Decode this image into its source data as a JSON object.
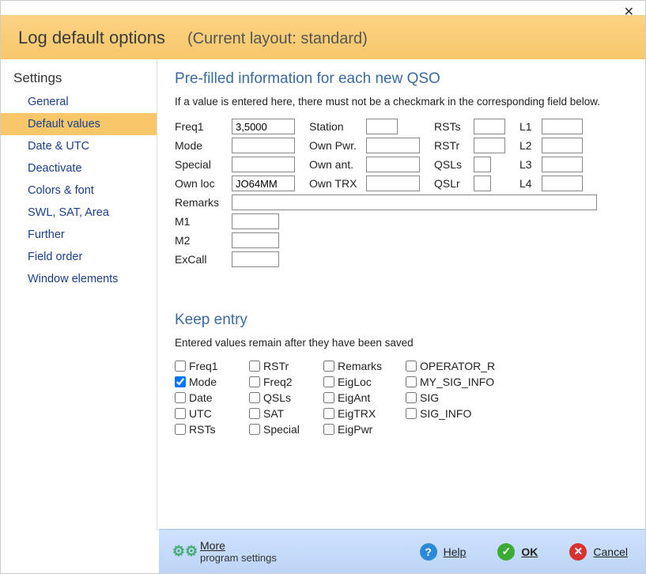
{
  "window": {
    "close": "✕"
  },
  "header": {
    "title": "Log default options",
    "layout": "(Current layout: standard)"
  },
  "sidebar": {
    "title": "Settings",
    "items": [
      {
        "label": "General"
      },
      {
        "label": "Default values"
      },
      {
        "label": "Date & UTC"
      },
      {
        "label": "Deactivate"
      },
      {
        "label": "Colors & font"
      },
      {
        "label": "SWL, SAT, Area"
      },
      {
        "label": "Further"
      },
      {
        "label": "Field order"
      },
      {
        "label": "Window elements"
      }
    ],
    "active_index": 1
  },
  "prefilled": {
    "title": "Pre-filled information for each new QSO",
    "note": "If a value is entered here, there must not be a checkmark in the corresponding field below.",
    "labels": {
      "freq1": "Freq1",
      "mode": "Mode",
      "special": "Special",
      "ownloc": "Own loc",
      "station": "Station",
      "ownpwr": "Own Pwr.",
      "ownant": "Own ant.",
      "owntrx": "Own TRX",
      "rsts": "RSTs",
      "rstr": "RSTr",
      "qsls": "QSLs",
      "qslr": "QSLr",
      "l1": "L1",
      "l2": "L2",
      "l3": "L3",
      "l4": "L4",
      "remarks": "Remarks",
      "m1": "M1",
      "m2": "M2",
      "excall": "ExCall"
    },
    "values": {
      "freq1": "3,5000",
      "mode": "",
      "special": "",
      "ownloc": "JO64MM",
      "station": "",
      "ownpwr": "",
      "ownant": "",
      "owntrx": "",
      "rsts": "",
      "rstr": "",
      "qsls": "",
      "qslr": "",
      "l1": "",
      "l2": "",
      "l3": "",
      "l4": "",
      "remarks": "",
      "m1": "",
      "m2": "",
      "excall": ""
    }
  },
  "keep": {
    "title": "Keep entry",
    "note": "Entered values remain after they have been saved",
    "items": [
      {
        "label": "Freq1",
        "checked": false
      },
      {
        "label": "RSTr",
        "checked": false
      },
      {
        "label": "Remarks",
        "checked": false
      },
      {
        "label": "OPERATOR_R",
        "checked": false
      },
      {
        "label": "Mode",
        "checked": true
      },
      {
        "label": "Freq2",
        "checked": false
      },
      {
        "label": "EigLoc",
        "checked": false
      },
      {
        "label": "MY_SIG_INFO",
        "checked": false
      },
      {
        "label": "Date",
        "checked": false
      },
      {
        "label": "QSLs",
        "checked": false
      },
      {
        "label": "EigAnt",
        "checked": false
      },
      {
        "label": "SIG",
        "checked": false
      },
      {
        "label": "UTC",
        "checked": false
      },
      {
        "label": "SAT",
        "checked": false
      },
      {
        "label": "EigTRX",
        "checked": false
      },
      {
        "label": "SIG_INFO",
        "checked": false
      },
      {
        "label": "RSTs",
        "checked": false
      },
      {
        "label": "Special",
        "checked": false
      },
      {
        "label": "EigPwr",
        "checked": false
      }
    ]
  },
  "footer": {
    "more": "More",
    "more_sub": "program settings",
    "help": "Help",
    "ok": "OK",
    "cancel": "Cancel"
  }
}
